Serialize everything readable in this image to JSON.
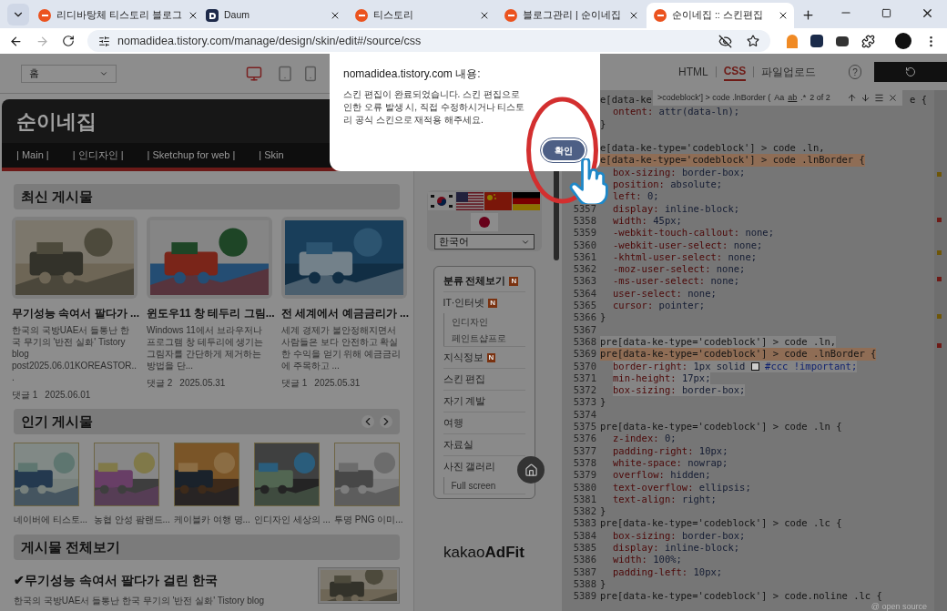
{
  "browser": {
    "tabs": [
      {
        "title": "리디바탕체 티스토리 블로그",
        "selected": false
      },
      {
        "title": "Daum",
        "selected": false
      },
      {
        "title": "티스토리",
        "selected": false
      },
      {
        "title": "블로그관리 | 순이네집",
        "selected": false
      },
      {
        "title": "순이네집 :: 스킨편집",
        "selected": true
      }
    ],
    "url": "nomadidea.tistory.com/manage/design/skin/edit#/source/css"
  },
  "preview": {
    "page_select": "홈",
    "blog_title": "순이네집",
    "nav": [
      "| Main |",
      "| 인디자인 |",
      "| Sketchup for web |",
      "| Skin"
    ],
    "recent": {
      "heading": "최신 게시물",
      "posts": [
        {
          "title": "무기성능 속여서 팔다가 ...",
          "excerpt": "한국의 국방UAE서 들통난 한국 무기의 '반전 실화' Tistory blog post2025.06.01KOREASTOR...",
          "comments": "댓글 1",
          "date": "2025.06.01"
        },
        {
          "title": "윈도우11 창 테두리 그림...",
          "excerpt": "Windows 11에서 브라우저나 프로그램 창 테두리에 생기는 그림자를 간단하게 제거하는 방법을 단...",
          "comments": "댓글 2",
          "date": "2025.05.31"
        },
        {
          "title": "전 세계에서 예금금리가 ...",
          "excerpt": "세계 경제가 불안정해지면서 사람들은 보다 안전하고 확실한 수익을 얻기 위해 예금금리에 주목하고 ...",
          "comments": "댓글 1",
          "date": "2025.05.31"
        }
      ]
    },
    "popular": {
      "heading": "인기 게시물",
      "posts": [
        "네이버에 티스토...",
        "농협 안성 팜랜드...",
        "케이블카 여행 명...",
        "인디자인 세상의 ...",
        "투명 PNG 이미..."
      ]
    },
    "all": {
      "heading": "게시물 전체보기",
      "title": "✔무기성능 속여서 팔다가 걸린 한국",
      "excerpt": "한국의 국방UAE서 들통난 한국 무기의 '반전 실화' Tistory blog"
    }
  },
  "sidebar": {
    "language": "한국어",
    "categories": [
      {
        "label": "분류 전체보기",
        "badge": "N"
      },
      {
        "label": "IT·인터넷",
        "badge": "N",
        "children": [
          "인디자인",
          "페인트샵프로"
        ]
      },
      {
        "label": "지식정보",
        "badge": "N"
      },
      {
        "label": "스킨 편집"
      },
      {
        "label": "자기 계발"
      },
      {
        "label": "여행"
      },
      {
        "label": "자료실"
      },
      {
        "label": "사진 갤러리",
        "children": [
          "Full screen"
        ]
      }
    ],
    "ad_logo": {
      "light": "kakao",
      "bold": "AdFit"
    }
  },
  "editor": {
    "tabs": [
      {
        "label": "HTML",
        "selected": false
      },
      {
        "label": "CSS",
        "selected": true
      },
      {
        "label": "파일업로드",
        "selected": false
      }
    ],
    "help": "?",
    "find": {
      "query": ">codeblock'] > code .lnBorder (",
      "case": "Aa",
      "word": "ab",
      "regex": ".*",
      "count": "2 of 2"
    },
    "lines": [
      {
        "kind": "selector",
        "code": "e[data-ke",
        "tail": "e {"
      },
      {
        "kind": "prop",
        "code": "ontent:",
        "value": "attr(data-ln);"
      },
      {
        "kind": "plain",
        "code": "}"
      },
      {
        "kind": "blank"
      },
      {
        "kind": "selector",
        "code": "e[data-ke-type='codeblock'] > code .ln,"
      },
      {
        "kind": "selector",
        "code": "e[data-ke-type='codeblock'] > code .lnBorder {",
        "current_match": true
      },
      {
        "kind": "prop",
        "code": "box-sizing:",
        "value": "border-box;"
      },
      {
        "kind": "prop",
        "code": "position:",
        "value": "absolute;"
      },
      {
        "kind": "prop",
        "code": "left:",
        "value": "0;"
      },
      {
        "num": "5357",
        "kind": "prop",
        "code": "display:",
        "value": "inline-block;"
      },
      {
        "num": "5358",
        "kind": "prop",
        "code": "width:",
        "value": "45px;"
      },
      {
        "num": "5359",
        "kind": "prop",
        "code": "-webkit-touch-callout:",
        "value": "none;"
      },
      {
        "num": "5360",
        "kind": "prop",
        "code": "-webkit-user-select:",
        "value": "none;"
      },
      {
        "num": "5361",
        "kind": "prop",
        "code": "-khtml-user-select:",
        "value": "none;"
      },
      {
        "num": "5362",
        "kind": "prop",
        "code": "-moz-user-select:",
        "value": "none;"
      },
      {
        "num": "5363",
        "kind": "prop",
        "code": "-ms-user-select:",
        "value": "none;"
      },
      {
        "num": "5364",
        "kind": "prop",
        "code": "user-select:",
        "value": "none;"
      },
      {
        "num": "5365",
        "kind": "prop",
        "code": "cursor:",
        "value": "pointer;"
      },
      {
        "num": "5366",
        "kind": "plain",
        "code": "}"
      },
      {
        "num": "5367",
        "kind": "blank"
      },
      {
        "num": "5368",
        "kind": "selector",
        "code": "pre[data-ke-type='codeblock'] > code .ln,",
        "selected": true
      },
      {
        "num": "5369",
        "kind": "selector",
        "code": "pre[data-ke-type='codeblock'] > code .lnBorder {",
        "current_match": true
      },
      {
        "num": "5370",
        "kind": "prop",
        "code": "border-right:",
        "value": "1px solid",
        "color": "#cccccc",
        "extra": "#ccc !important;",
        "selected": true
      },
      {
        "num": "5371",
        "kind": "prop",
        "code": "min-height:",
        "value": "17px;",
        "selected": true
      },
      {
        "num": "5372",
        "kind": "prop",
        "code": "box-sizing:",
        "value": "border-box;",
        "selected": true
      },
      {
        "num": "5373",
        "kind": "plain",
        "code": "}"
      },
      {
        "num": "5374",
        "kind": "blank"
      },
      {
        "num": "5375",
        "kind": "selector",
        "code": "pre[data-ke-type='codeblock'] > code .ln {"
      },
      {
        "num": "5376",
        "kind": "prop",
        "code": "z-index:",
        "value": "0;"
      },
      {
        "num": "5377",
        "kind": "prop",
        "code": "padding-right:",
        "value": "10px;"
      },
      {
        "num": "5378",
        "kind": "prop",
        "code": "white-space:",
        "value": "nowrap;"
      },
      {
        "num": "5379",
        "kind": "prop",
        "code": "overflow:",
        "value": "hidden;"
      },
      {
        "num": "5380",
        "kind": "prop",
        "code": "text-overflow:",
        "value": "ellipsis;"
      },
      {
        "num": "5381",
        "kind": "prop",
        "code": "text-align:",
        "value": "right;"
      },
      {
        "num": "5382",
        "kind": "plain",
        "code": "}"
      },
      {
        "num": "5383",
        "kind": "selector",
        "code": "pre[data-ke-type='codeblock'] > code .lc {"
      },
      {
        "num": "5384",
        "kind": "prop",
        "code": "box-sizing:",
        "value": "border-box;"
      },
      {
        "num": "5385",
        "kind": "prop",
        "code": "display:",
        "value": "inline-block;"
      },
      {
        "num": "5386",
        "kind": "prop",
        "code": "width:",
        "value": "100%;"
      },
      {
        "num": "5387",
        "kind": "prop",
        "code": "padding-left:",
        "value": "10px;"
      },
      {
        "num": "5388",
        "kind": "plain",
        "code": "}"
      },
      {
        "num": "5389",
        "kind": "selector",
        "code": "pre[data-ke-type='codeblock'] > code.noline .lc {"
      }
    ],
    "footer": "@ open source"
  },
  "dialog": {
    "title": "nomadidea.tistory.com 내용:",
    "message": "스킨 편집이 완료되었습니다. 스킨 편집으로 인한 오류 발생 시, 직접 수정하시거나 티스토리 공식 스킨으로 재적용 해주세요.",
    "button": "확인"
  }
}
